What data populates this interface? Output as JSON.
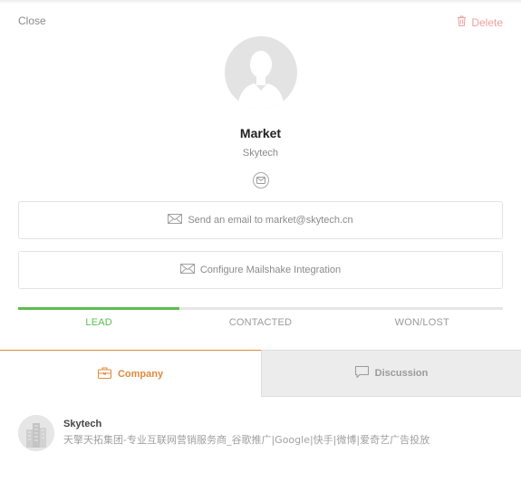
{
  "header": {
    "close_label": "Close",
    "delete_label": "Delete",
    "delete_icon": "trash-icon",
    "delete_color": "#f0a0a0"
  },
  "contact": {
    "avatar_icon": "user-avatar-icon",
    "name": "Market",
    "company": "Skytech",
    "email_icon": "envelope-icon"
  },
  "actions": {
    "send_email_label": "Send an email to market@skytech.cn",
    "mailshake_label": "Configure Mailshake Integration",
    "icon": "envelope-icon"
  },
  "pipeline": {
    "stages": [
      "LEAD",
      "CONTACTED",
      "WON/LOST"
    ],
    "active_stage": "LEAD",
    "progress_fraction": 0.333,
    "active_color": "#5cbe4f"
  },
  "tabs": {
    "company_label": "Company",
    "discussion_label": "Discussion",
    "active_tab": "Company",
    "company_icon": "briefcase-icon",
    "discussion_icon": "speech-bubble-icon",
    "active_color": "#e08a3c"
  },
  "company_card": {
    "name": "Skytech",
    "description": "天擎天拓集团-专业互联网营销服务商_谷歌推广|Google|快手|微博|爱奇艺广告投放",
    "logo_icon": "building-logo-icon"
  }
}
